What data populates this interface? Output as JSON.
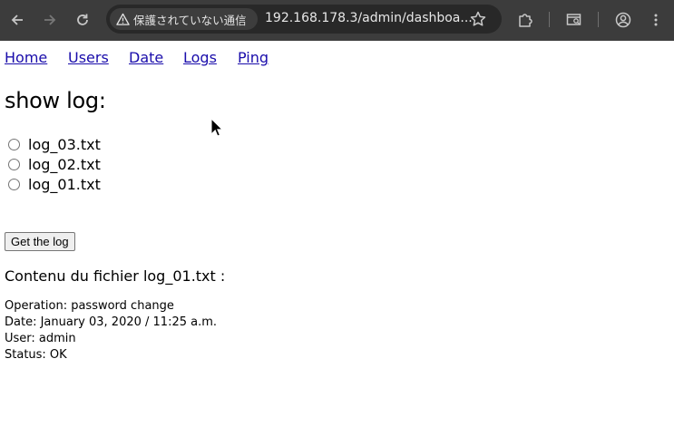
{
  "browser": {
    "security_label": "保護されていない通信",
    "url": "192.168.178.3/admin/dashboa..."
  },
  "nav": {
    "items": [
      "Home",
      "Users",
      "Date",
      "Logs",
      "Ping"
    ]
  },
  "page": {
    "title": "show log:",
    "log_files": [
      "log_03.txt",
      "log_02.txt",
      "log_01.txt"
    ],
    "button_label": "Get the log",
    "content_heading": "Contenu du fichier log_01.txt :",
    "log_content": [
      "Operation: password change",
      "Date: January 03, 2020 / 11:25 a.m.",
      "User: admin",
      "Status: OK"
    ]
  },
  "colors": {
    "toolbar": "#3c3c3c",
    "link": "#1a0dab"
  }
}
